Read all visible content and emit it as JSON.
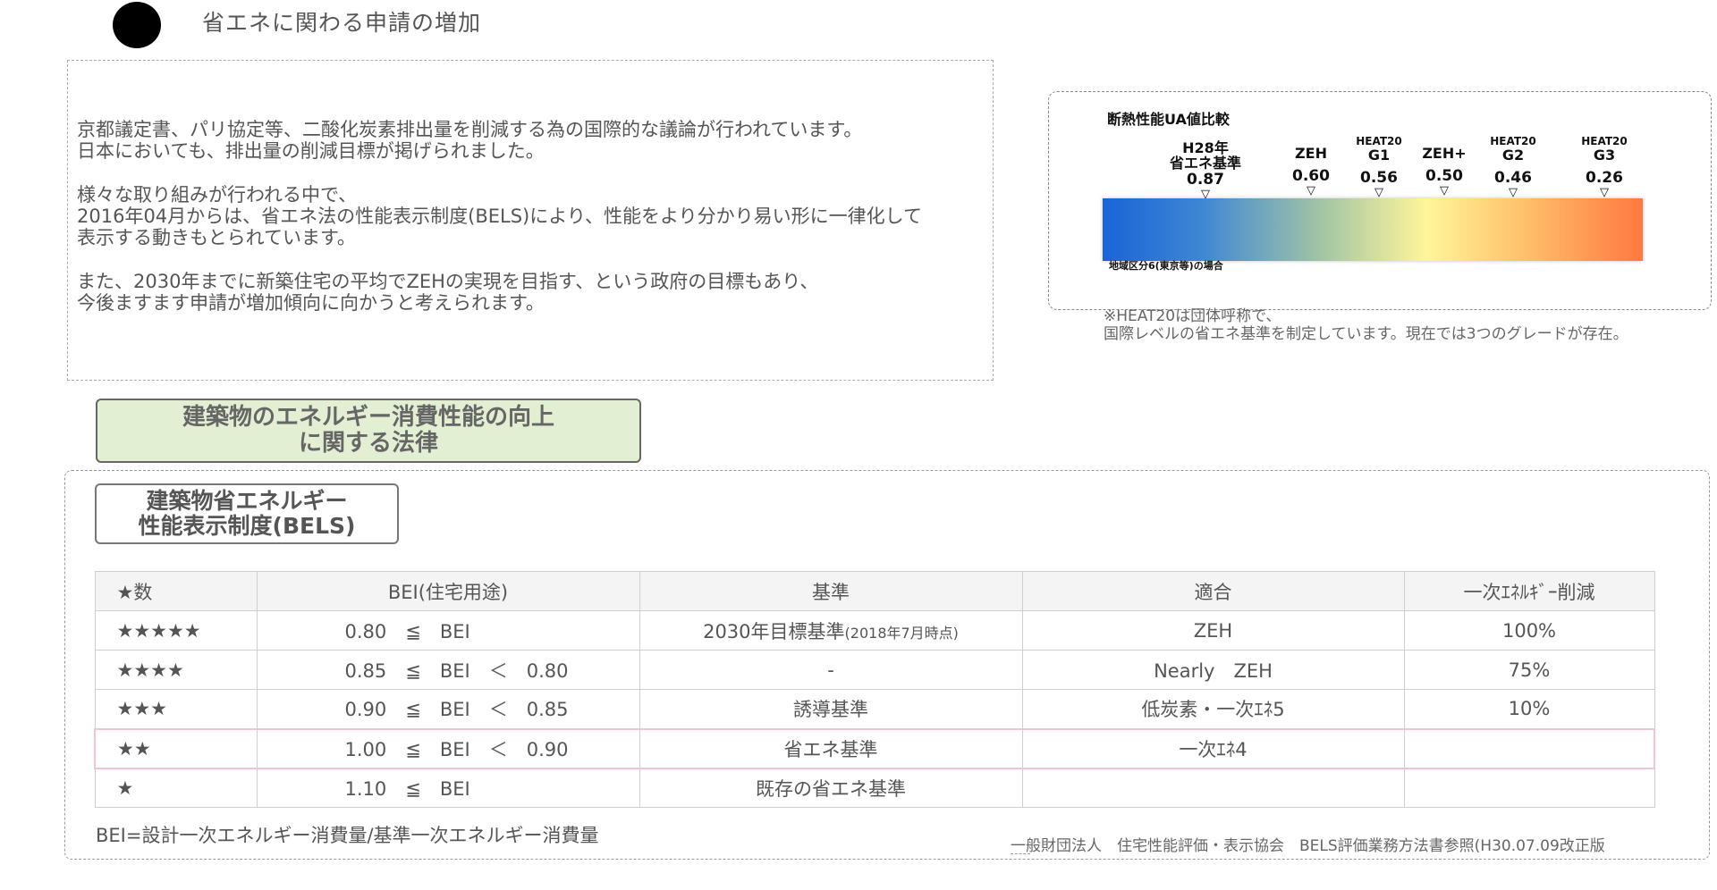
{
  "heading": "省エネに関わる申請の増加",
  "intro": {
    "line1": "京都議定書、パリ協定等、二酸化炭素排出量を削減する為の国際的な議論が行われています。",
    "line2": "日本においても、排出量の削減目標が掲げられました。",
    "line3": "様々な取り組みが行われる中で、",
    "line4": "2016年04月からは、省エネ法の性能表示制度(BELS)により、性能をより分かり易い形に一律化して",
    "line5": "表示する動きもとられています。",
    "line6": "また、2030年までに新築住宅の平均でZEHの実現を目指す、という政府の目標もあり、",
    "line7": "今後ますます申請が増加傾向に向かうと考えられます。"
  },
  "ua_chart": {
    "title": "断熱性能UA値比較",
    "markers": [
      {
        "label": "H28年\n省エネ基準",
        "value": "0.87"
      },
      {
        "label": "ZEH",
        "value": "0.60"
      },
      {
        "label_top": "HEAT20",
        "label": "G1",
        "value": "0.56"
      },
      {
        "label": "ZEH+",
        "value": "0.50"
      },
      {
        "label_top": "HEAT20",
        "label": "G2",
        "value": "0.46"
      },
      {
        "label_top": "HEAT20",
        "label": "G3",
        "value": "0.26"
      }
    ],
    "marker_symbol": "▽",
    "region_note": "地域区分6(東京等)の場合",
    "gradient_colors": [
      "#1a64d8",
      "#fff59a",
      "#ff7840"
    ]
  },
  "heat_note": "※HEAT20は団体呼称で、\n国際レベルの省エネ基準を制定しています。現在では3つのグレードが存在。",
  "law_box": "建築物のエネルギー消費性能の向上\nに関する法律",
  "bels_label": "建築物省エネルギー\n性能表示制度(BELS)",
  "table": {
    "headers": [
      "★数",
      "BEI(住宅用途)",
      "基準",
      "適合",
      "一次ｴﾈﾙｷﾞｰ削減"
    ],
    "rows": [
      {
        "stars": "★★★★★",
        "bei": "0.80　≦　BEI",
        "standard": "2030年目標基準",
        "standard_note": "(2018年7月時点)",
        "fit": "ZEH",
        "reduction": "100%"
      },
      {
        "stars": "★★★★",
        "bei": "0.85　≦　BEI　＜　0.80",
        "standard": "-",
        "standard_note": "",
        "fit": "Nearly　ZEH",
        "reduction": "75%"
      },
      {
        "stars": "★★★",
        "bei": "0.90　≦　BEI　＜　0.85",
        "standard": "誘導基準",
        "standard_note": "",
        "fit": "低炭素・一次ｴﾈ5",
        "reduction": "10%"
      },
      {
        "stars": "★★",
        "bei": "1.00　≦　BEI　＜　0.90",
        "standard": "省エネ基準",
        "standard_note": "",
        "fit": "一次ｴﾈ4",
        "reduction": ""
      },
      {
        "stars": "★",
        "bei": "1.10　≦　BEI",
        "standard": "既存の省エネ基準",
        "standard_note": "",
        "fit": "",
        "reduction": ""
      }
    ]
  },
  "bei_formula": "BEI=設計一次エネルギー消費量/基準一次エネルギー消費量",
  "source_note": "一般財団法人　住宅性能評価・表示協会　BELS評価業務方法書参照(H30.07.09改正版"
}
